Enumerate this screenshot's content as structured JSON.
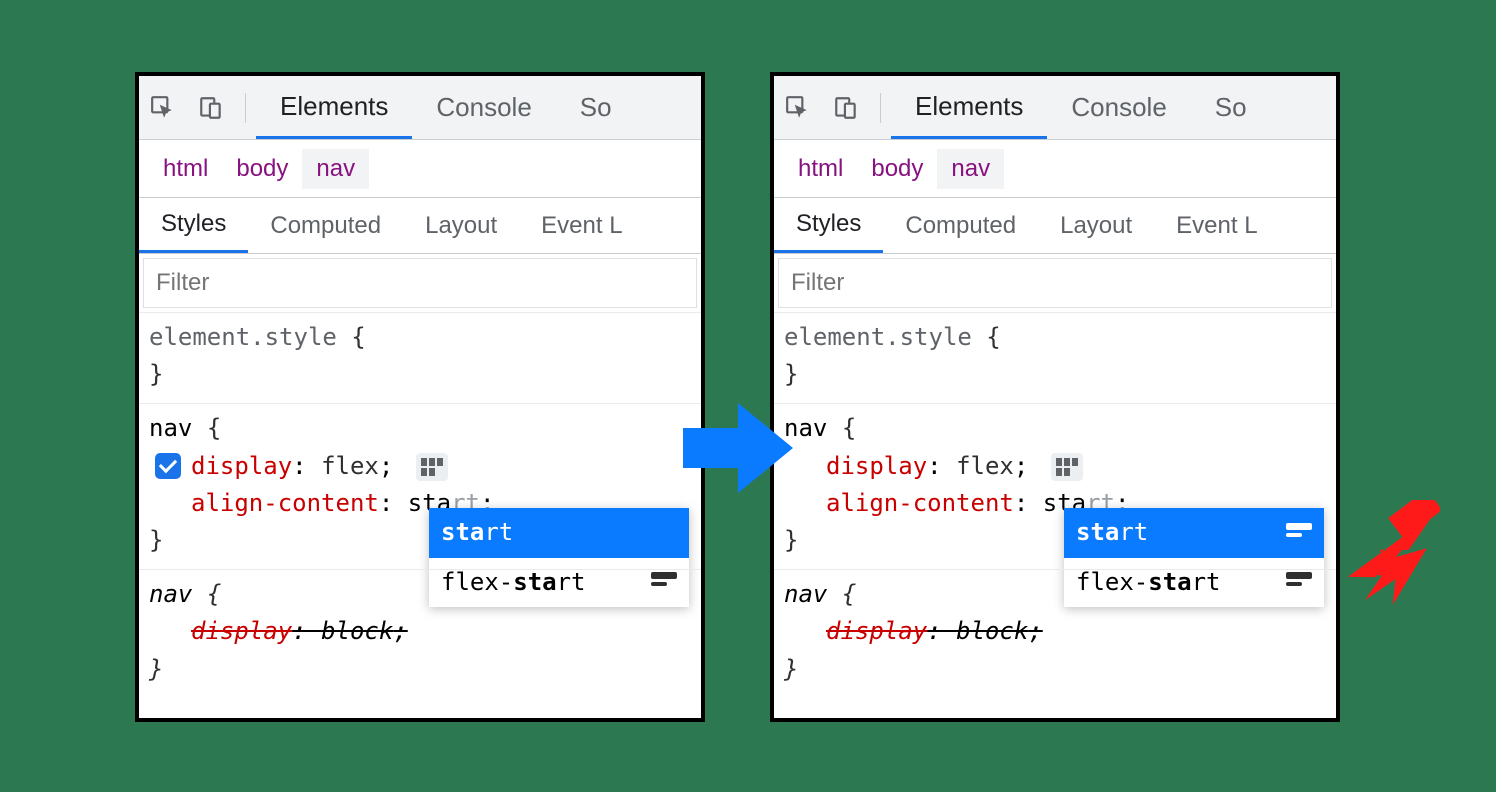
{
  "toolbar": {
    "tabs": {
      "elements": "Elements",
      "console": "Console",
      "sources": "So"
    }
  },
  "breadcrumbs": {
    "items": [
      "html",
      "body",
      "nav"
    ]
  },
  "subtabs": {
    "styles": "Styles",
    "computed": "Computed",
    "layout": "Layout",
    "event": "Event L"
  },
  "filter": {
    "placeholder": "Filter"
  },
  "rules": {
    "element_style": {
      "selector": "element.style",
      "open": "{",
      "close": "}"
    },
    "nav_main": {
      "selector": "nav",
      "open": "{",
      "close": "}",
      "display": {
        "name": "display",
        "value": "flex"
      },
      "align_content": {
        "name": "align-content",
        "typed_bold": "sta",
        "typed_rest": "rt",
        "suffix": ";"
      }
    },
    "nav_ua": {
      "selector": "nav",
      "open": "{",
      "close": "}",
      "display": {
        "name": "display",
        "value": "block"
      }
    }
  },
  "autocomplete": {
    "left": {
      "item1": {
        "bold": "sta",
        "rest": "rt"
      },
      "item2": {
        "pre": "flex-",
        "bold": "sta",
        "rest": "rt"
      }
    },
    "right": {
      "item1": {
        "bold": "sta",
        "rest": "rt"
      },
      "item2": {
        "pre": "flex-",
        "bold": "sta",
        "rest": "rt"
      }
    }
  },
  "colors": {
    "accent": "#1a73e8",
    "selection": "#0a7aff",
    "prop": "#c80000",
    "crumb": "#881280"
  }
}
